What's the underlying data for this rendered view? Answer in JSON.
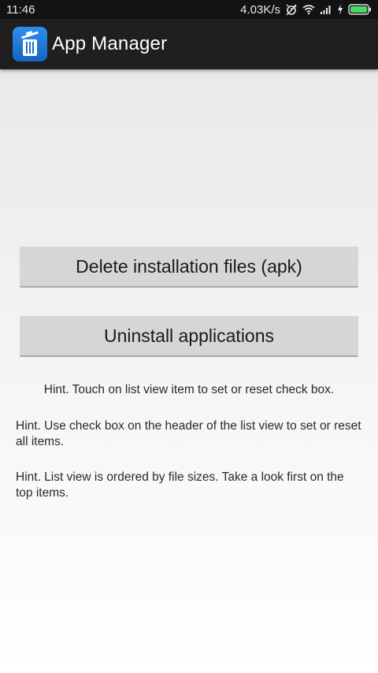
{
  "status_bar": {
    "time": "11:46",
    "network_speed": "4.03K/s",
    "icons": [
      "alarm-off-icon",
      "wifi-icon",
      "signal-icon",
      "charging-icon",
      "battery-icon"
    ],
    "battery_color": "#4cd964"
  },
  "app_bar": {
    "icon": "trash-can-icon",
    "title": "App Manager",
    "icon_color": "#1e88e5"
  },
  "actions": {
    "delete_apk_label": "Delete installation files (apk)",
    "uninstall_label": "Uninstall applications"
  },
  "hints": [
    "Hint. Touch on list view item to set or reset check box.",
    "Hint. Use check box on the header of the list view to set or reset all items.",
    "Hint. List view is ordered by file sizes. Take a look first on the top items."
  ]
}
